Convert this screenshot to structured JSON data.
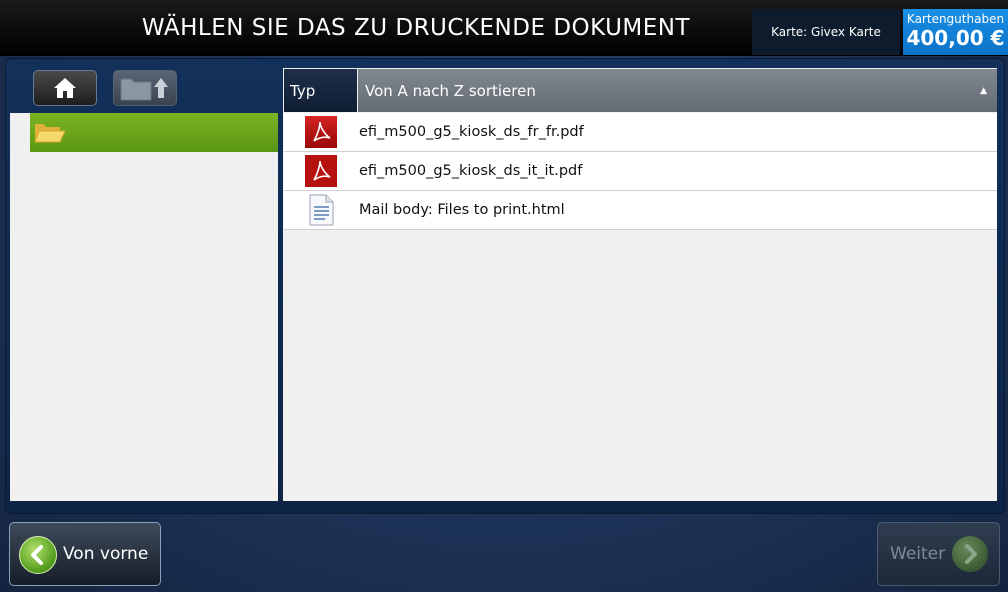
{
  "header": {
    "title": "WÄHLEN SIE DAS ZU DRUCKENDE DOKUMENT",
    "card_label": "Karte: Givex Karte",
    "balance_label": "Kartenguthaben",
    "balance_amount": "400,00 €"
  },
  "left_nav": {
    "home_icon": "home-icon",
    "folder_up_icon": "folder-up-icon",
    "folders": [
      {
        "icon": "folder-open-icon",
        "label": ""
      }
    ]
  },
  "file_list": {
    "col_type": "Typ",
    "sort_label": "Von A nach Z sortieren",
    "files": [
      {
        "icon": "pdf-icon",
        "name": "efi_m500_g5_kiosk_ds_fr_fr.pdf"
      },
      {
        "icon": "pdf-icon",
        "name": "efi_m500_g5_kiosk_ds_it_it.pdf"
      },
      {
        "icon": "document-icon",
        "name": "Mail body: Files to print.html"
      }
    ]
  },
  "footer": {
    "back_label": "Von vorne",
    "next_label": "Weiter"
  },
  "colors": {
    "accent_green": "#6aa51a",
    "balance_blue": "#0a73c8"
  }
}
